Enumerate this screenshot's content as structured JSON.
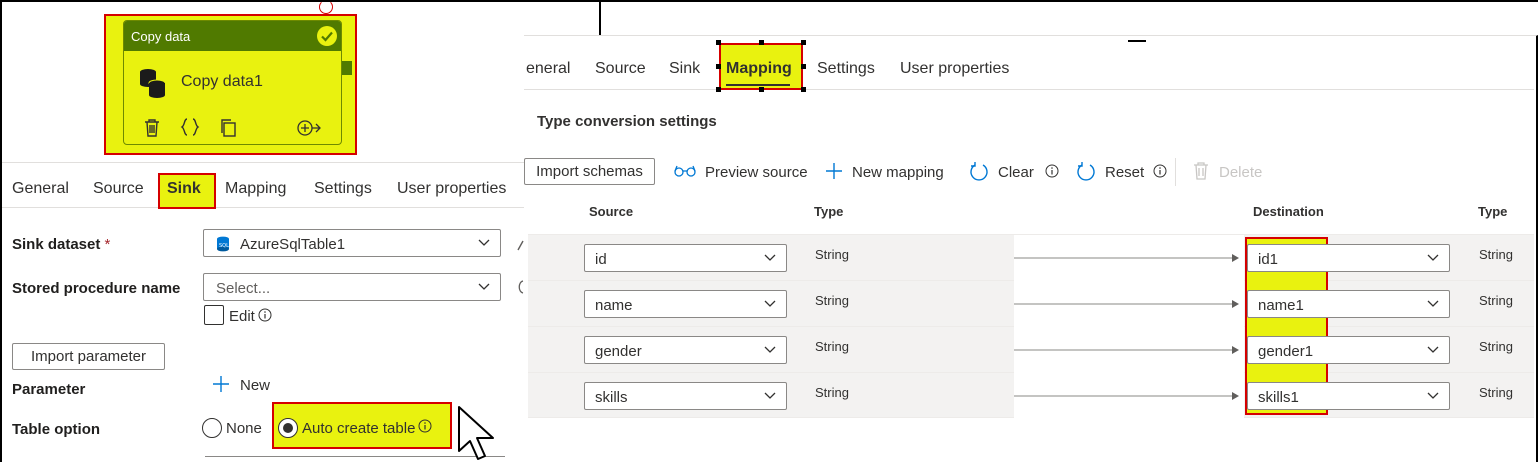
{
  "colors": {
    "highlight_yellow": "#e9f20f",
    "highlight_border": "#d50000",
    "activity_header": "#507a00"
  },
  "activity": {
    "type_label": "Copy data",
    "name": "Copy data1",
    "icons": [
      "copy-data-db-icon",
      "delete-icon",
      "code-braces-icon",
      "clone-icon",
      "add-output-icon",
      "success-check-icon"
    ]
  },
  "left_tabs": [
    "General",
    "Source",
    "Sink",
    "Mapping",
    "Settings",
    "User properties"
  ],
  "sink_form": {
    "sink_dataset_label": "Sink dataset",
    "required_mark": "*",
    "sink_dataset_value": "AzureSqlTable1",
    "stored_procedure_label": "Stored procedure name",
    "stored_procedure_placeholder": "Select...",
    "edit_label": "Edit",
    "import_parameter_button": "Import parameter",
    "parameter_label": "Parameter",
    "new_label": "New",
    "table_option_label": "Table option",
    "table_option_none": "None",
    "table_option_auto": "Auto create table",
    "table_option_selected": "Auto create table"
  },
  "right_tabs": [
    "eneral",
    "Source",
    "Sink",
    "Mapping",
    "Settings",
    "User properties"
  ],
  "mapping": {
    "type_conversion_label": "Type conversion settings",
    "toolbar": {
      "import_schemas": "Import schemas",
      "preview_source": "Preview source",
      "new_mapping": "New mapping",
      "clear": "Clear",
      "reset": "Reset",
      "delete": "Delete"
    },
    "headers": {
      "source": "Source",
      "source_type": "Type",
      "destination": "Destination",
      "destination_type": "Type"
    },
    "rows": [
      {
        "source": "id",
        "source_type": "String",
        "destination": "id1",
        "destination_type": "String"
      },
      {
        "source": "name",
        "source_type": "String",
        "destination": "name1",
        "destination_type": "String"
      },
      {
        "source": "gender",
        "source_type": "String",
        "destination": "gender1",
        "destination_type": "String"
      },
      {
        "source": "skills",
        "source_type": "String",
        "destination": "skills1",
        "destination_type": "String"
      }
    ]
  }
}
